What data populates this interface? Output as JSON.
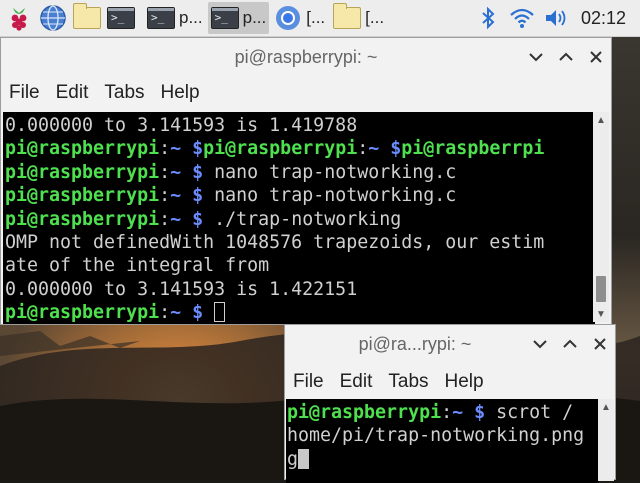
{
  "taskbar": {
    "tasks": [
      {
        "label": "",
        "icon": "terminal-icon"
      },
      {
        "label": "p...",
        "icon": "terminal-icon"
      },
      {
        "label": "p...",
        "icon": "terminal-icon",
        "active": true
      },
      {
        "label": "[...",
        "icon": "chromium-icon"
      },
      {
        "label": "[...",
        "icon": "folder-icon"
      }
    ],
    "clock": "02:12"
  },
  "window_main": {
    "title": "pi@raspberrypi: ~",
    "menu": [
      "File",
      "Edit",
      "Tabs",
      "Help"
    ],
    "lines": [
      [
        {
          "c": "t",
          "s": "0.000000 to 3.141593 is 1.419788"
        }
      ],
      [
        {
          "c": "g",
          "s": "pi@raspberrypi"
        },
        {
          "c": "t",
          "s": ":"
        },
        {
          "c": "b",
          "s": "~ $"
        },
        {
          "c": "g",
          "s": "pi@raspberrypi"
        },
        {
          "c": "t",
          "s": ":"
        },
        {
          "c": "b",
          "s": "~ $"
        },
        {
          "c": "g",
          "s": "pi@raspberrpi"
        }
      ],
      [
        {
          "c": "g",
          "s": "pi@raspberrypi"
        },
        {
          "c": "t",
          "s": ":"
        },
        {
          "c": "b",
          "s": "~ $"
        },
        {
          "c": "t",
          "s": " nano trap-notworking.c"
        }
      ],
      [
        {
          "c": "g",
          "s": "pi@raspberrypi"
        },
        {
          "c": "t",
          "s": ":"
        },
        {
          "c": "b",
          "s": "~ $"
        },
        {
          "c": "t",
          "s": " nano trap-notworking.c"
        }
      ],
      [
        {
          "c": "g",
          "s": "pi@raspberrypi"
        },
        {
          "c": "t",
          "s": ":"
        },
        {
          "c": "b",
          "s": "~ $"
        },
        {
          "c": "t",
          "s": " ./trap-notworking"
        }
      ],
      [
        {
          "c": "t",
          "s": "OMP not definedWith 1048576 trapezoids, our estim"
        }
      ],
      [
        {
          "c": "t",
          "s": "ate of the integral from"
        }
      ],
      [
        {
          "c": "t",
          "s": "0.000000 to 3.141593 is 1.422151"
        }
      ],
      [
        {
          "c": "g",
          "s": "pi@raspberrypi"
        },
        {
          "c": "t",
          "s": ":"
        },
        {
          "c": "b",
          "s": "~ $"
        },
        {
          "c": "t",
          "s": " "
        },
        {
          "c": "cursor",
          "s": ""
        }
      ]
    ]
  },
  "window_small": {
    "title": "pi@ra...rypi: ~",
    "menu": [
      "File",
      "Edit",
      "Tabs",
      "Help"
    ],
    "lines": [
      [
        {
          "c": "g",
          "s": "pi@raspberrypi"
        },
        {
          "c": "t",
          "s": ":"
        },
        {
          "c": "b",
          "s": "~ $"
        },
        {
          "c": "t",
          "s": " scrot /"
        }
      ],
      [
        {
          "c": "t",
          "s": "home/pi/trap-notworking.png"
        }
      ],
      [
        {
          "c": "t",
          "s": "g"
        },
        {
          "c": "cursorfill",
          "s": ""
        }
      ]
    ]
  }
}
